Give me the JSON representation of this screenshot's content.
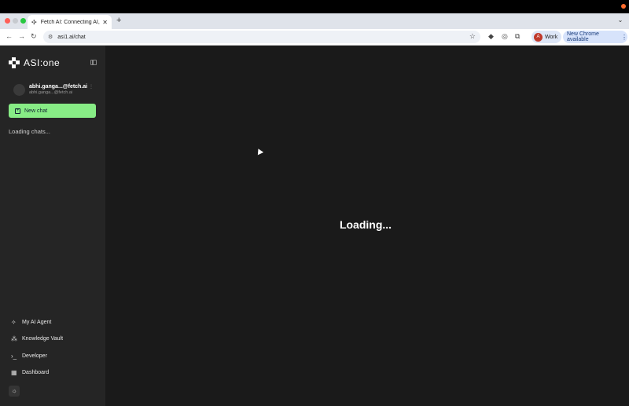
{
  "browser": {
    "tab_title": "Fetch AI: Connecting AI, Web",
    "new_tab": "+",
    "url": "asi1.ai/chat",
    "profile_initial": "A",
    "profile_label": "Work",
    "update_label": "New Chrome available"
  },
  "sidebar": {
    "logo_text": "ASI:one",
    "user_name": "abhi.ganga...@fetch.ai",
    "user_email": "abhi.ganga...@fetch.ai",
    "new_chat_label": "New chat",
    "loading_chats": "Loading chats...",
    "nav": [
      {
        "label": "My AI Agent",
        "icon": "sparkle-icon"
      },
      {
        "label": "Knowledge Vault",
        "icon": "network-icon"
      },
      {
        "label": "Developer",
        "icon": "terminal-icon"
      },
      {
        "label": "Dashboard",
        "icon": "grid-icon"
      }
    ]
  },
  "main": {
    "loading_text": "Loading..."
  },
  "colors": {
    "accent": "#87ec85",
    "sidebar_bg": "#252525",
    "main_bg": "#1a1a1a"
  }
}
